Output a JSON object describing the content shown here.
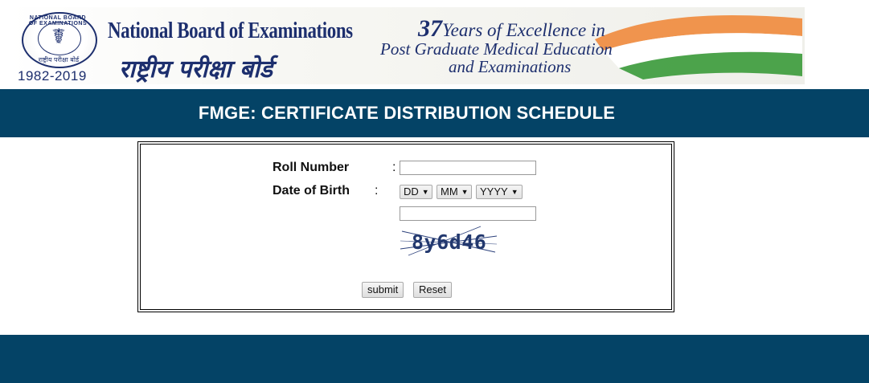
{
  "banner": {
    "logo_arc_text": "NATIONAL BOARD OF EXAMINATIONS",
    "logo_hindi_text": "राष्ट्रीय परीक्षा बोर्ड",
    "years_text": "1982-2019",
    "org_name_en": "National Board of Examinations",
    "org_name_hi": "राष्ट्रीय परीक्षा बोर्ड",
    "tagline_number": "37",
    "tagline_line1": "Years of Excellence in",
    "tagline_line2": "Post Graduate Medical Education",
    "tagline_line3": "and Examinations",
    "flag_colors": {
      "saffron": "#f08a3c",
      "white": "#ffffff",
      "green": "#3a9a3a"
    }
  },
  "header": {
    "title": "FMGE: CERTIFICATE DISTRIBUTION SCHEDULE"
  },
  "form": {
    "roll_number_label": "Roll Number",
    "roll_number_colon": ":",
    "roll_number_value": "",
    "dob_label": "Date of Birth",
    "dob_colon": ":",
    "dob_day": "DD",
    "dob_month": "MM",
    "dob_year": "YYYY",
    "captcha_input_value": "",
    "captcha_text": "8y6d46",
    "submit_label": "submit",
    "reset_label": "Reset"
  },
  "colors": {
    "bar": "#044366",
    "header_text": "#ffffff",
    "brand_blue": "#1d2f6e"
  }
}
